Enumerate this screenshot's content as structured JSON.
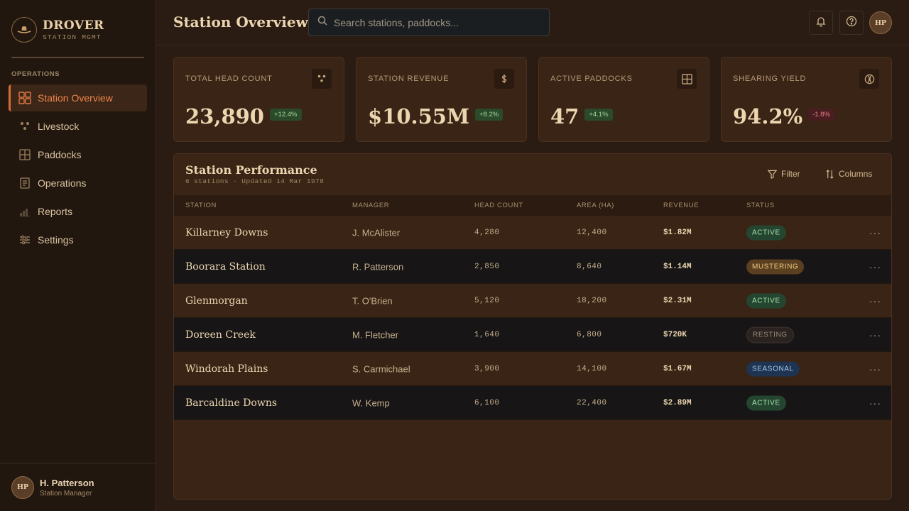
{
  "brand": {
    "name": "DROVER",
    "sub": "STATION MGMT"
  },
  "sidebar": {
    "section": "OPERATIONS",
    "items": [
      {
        "label": "Station Overview",
        "icon": "grid-icon",
        "active": true
      },
      {
        "label": "Livestock",
        "icon": "livestock-icon"
      },
      {
        "label": "Paddocks",
        "icon": "paddocks-icon"
      },
      {
        "label": "Operations",
        "icon": "clipboard-icon"
      },
      {
        "label": "Reports",
        "icon": "bar-chart-icon"
      },
      {
        "label": "Settings",
        "icon": "sliders-icon"
      }
    ],
    "user": {
      "initials": "HP",
      "name": "H. Patterson",
      "role": "Station Manager"
    }
  },
  "header": {
    "title": "Station Overview",
    "search_placeholder": "Search stations, paddocks...",
    "avatar_initials": "HP"
  },
  "stats": [
    {
      "label": "TOTAL HEAD COUNT",
      "value": "23,890",
      "delta": "+12.4%",
      "trend": "up",
      "icon": "livestock-icon"
    },
    {
      "label": "STATION REVENUE",
      "value": "$10.55M",
      "delta": "+8.2%",
      "trend": "up",
      "icon": "dollar-icon"
    },
    {
      "label": "ACTIVE PADDOCKS",
      "value": "47",
      "delta": "+4.1%",
      "trend": "up",
      "icon": "paddocks-icon"
    },
    {
      "label": "SHEARING YIELD",
      "value": "94.2%",
      "delta": "-1.8%",
      "trend": "down",
      "icon": "wool-icon"
    }
  ],
  "table": {
    "title": "Station Performance",
    "subtitle": "6 stations · Updated 14 Mar 1978",
    "filter_label": "Filter",
    "columns_label": "Columns",
    "columns": [
      "STATION",
      "MANAGER",
      "HEAD COUNT",
      "AREA (HA)",
      "REVENUE",
      "STATUS"
    ],
    "rows": [
      {
        "station": "Killarney Downs",
        "manager": "J. McAlister",
        "head_count": "4,280",
        "area": "12,400",
        "revenue": "$1.82M",
        "status": "ACTIVE"
      },
      {
        "station": "Boorara Station",
        "manager": "R. Patterson",
        "head_count": "2,850",
        "area": "8,640",
        "revenue": "$1.14M",
        "status": "MUSTERING"
      },
      {
        "station": "Glenmorgan",
        "manager": "T. O'Brien",
        "head_count": "5,120",
        "area": "18,200",
        "revenue": "$2.31M",
        "status": "ACTIVE"
      },
      {
        "station": "Doreen Creek",
        "manager": "M. Fletcher",
        "head_count": "1,640",
        "area": "6,800",
        "revenue": "$720K",
        "status": "RESTING"
      },
      {
        "station": "Windorah Plains",
        "manager": "S. Carmichael",
        "head_count": "3,900",
        "area": "14,100",
        "revenue": "$1.67M",
        "status": "SEASONAL"
      },
      {
        "station": "Barcaldine Downs",
        "manager": "W. Kemp",
        "head_count": "6,100",
        "area": "22,400",
        "revenue": "$2.89M",
        "status": "ACTIVE"
      }
    ],
    "row_action": "···"
  },
  "colors": {
    "accent": "#d86a3a",
    "active": "#a8e0ae",
    "mustering": "#f0c880",
    "resting": "#9a8a78",
    "seasonal": "#a8c8f0"
  }
}
